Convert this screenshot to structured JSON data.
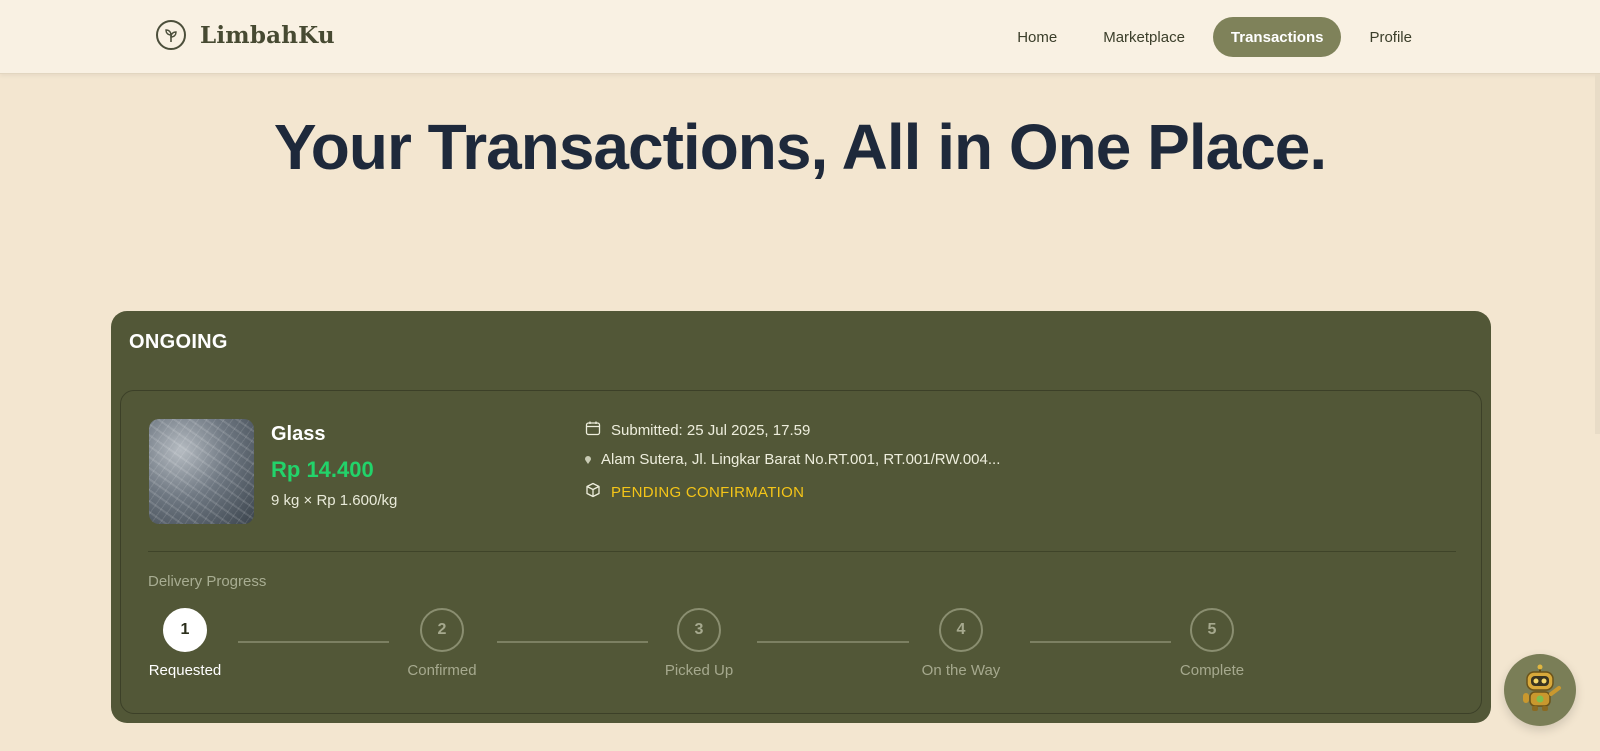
{
  "nav": {
    "brand": "LimbahKu",
    "brand_icon": "leaf-icon",
    "links": [
      {
        "label": "Home",
        "active": false
      },
      {
        "label": "Marketplace",
        "active": false
      },
      {
        "label": "Transactions",
        "active": true
      },
      {
        "label": "Profile",
        "active": false
      }
    ]
  },
  "hero": {
    "title": "Your Transactions, All in One Place."
  },
  "ongoing": {
    "heading": "ONGOING",
    "transaction": {
      "item_name": "Glass",
      "price": "Rp 14.400",
      "quantity": "9 kg × Rp 1.600/kg",
      "submitted": "Submitted: 25 Jul 2025, 17.59",
      "address": "Alam Sutera, Jl. Lingkar Barat No.RT.001, RT.001/RW.004...",
      "status": "PENDING CONFIRMATION",
      "progress": {
        "label": "Delivery Progress",
        "current_step": 1,
        "steps": [
          {
            "number": "1",
            "label": "Requested"
          },
          {
            "number": "2",
            "label": "Confirmed"
          },
          {
            "number": "3",
            "label": "Picked Up"
          },
          {
            "number": "4",
            "label": "On the Way"
          },
          {
            "number": "5",
            "label": "Complete"
          }
        ]
      }
    }
  },
  "colors": {
    "background": "#f3e6d0",
    "panel": "#525737",
    "accent": "#7f825a",
    "price": "#22d36a",
    "status_pending": "#f5c518"
  },
  "chatbot": {
    "icon": "robot-assistant-icon"
  }
}
